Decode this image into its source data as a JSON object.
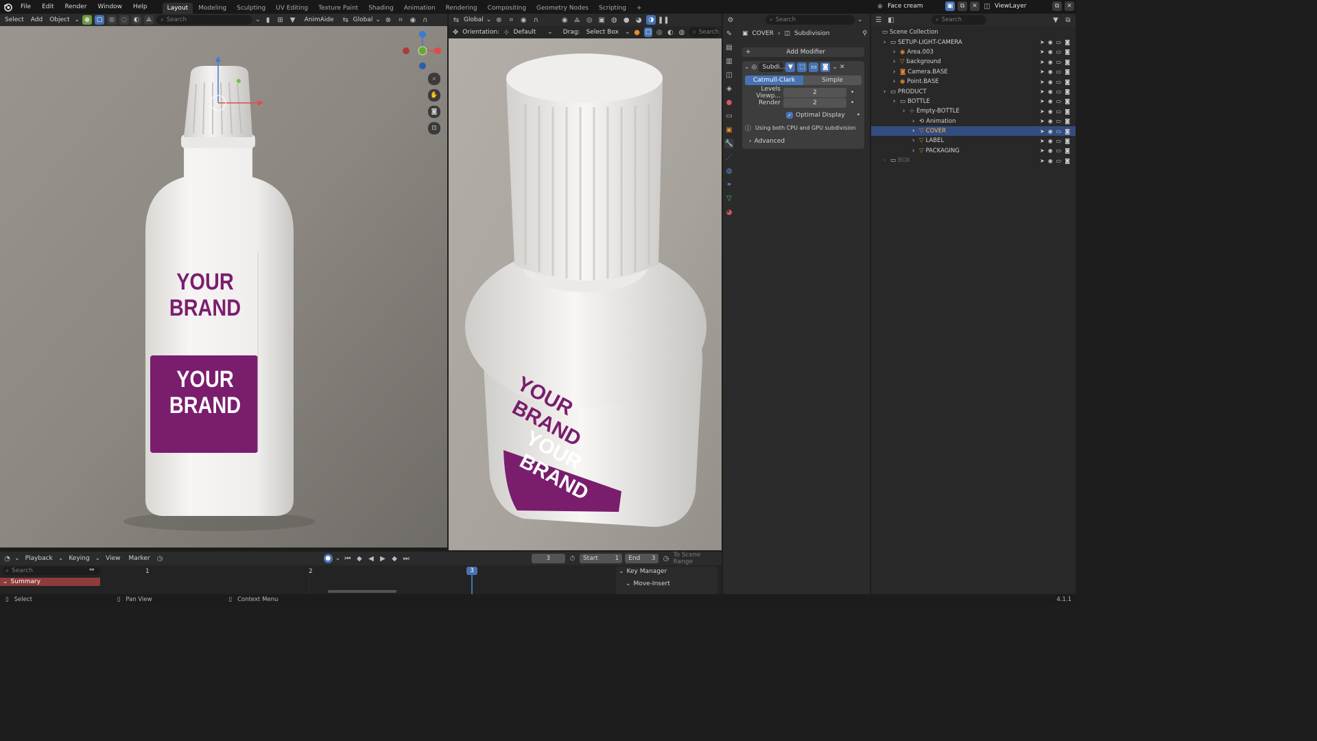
{
  "topmenu": {
    "items": [
      "File",
      "Edit",
      "Render",
      "Window",
      "Help"
    ]
  },
  "workspaces": [
    {
      "label": "Layout",
      "active": true
    },
    {
      "label": "Modeling"
    },
    {
      "label": "Sculpting"
    },
    {
      "label": "UV Editing"
    },
    {
      "label": "Texture Paint"
    },
    {
      "label": "Shading"
    },
    {
      "label": "Animation"
    },
    {
      "label": "Rendering"
    },
    {
      "label": "Compositing"
    },
    {
      "label": "Geometry Nodes"
    },
    {
      "label": "Scripting"
    }
  ],
  "scene_name": "Face cream",
  "view_layer": "ViewLayer",
  "viewport_left": {
    "menus": {
      "select": "Select",
      "add": "Add",
      "object": "Object"
    },
    "search_placeholder": "Search",
    "addon": "AnimAide",
    "transform": "Global"
  },
  "viewport_right": {
    "transform": "Global",
    "orientation_label": "Orientation:",
    "orientation_value": "Default",
    "drag_label": "Drag:",
    "drag_value": "Select Box",
    "search_placeholder": "Search"
  },
  "bottle": {
    "label_line1": "YOUR",
    "label_line2": "BRAND",
    "colors": {
      "band": "#7a1d6d",
      "text": "#7b1e6f",
      "body": "#ececea",
      "background": "#8d8780"
    }
  },
  "properties": {
    "search_placeholder": "Search",
    "breadcrumb_object": "COVER",
    "breadcrumb_modifier": "Subdivision",
    "add_modifier": "Add Modifier",
    "modifier_name": "Subdi...",
    "tabs": [
      "Catmull-Clark",
      "Simple"
    ],
    "levels_viewport_label": "Levels Viewp...",
    "levels_viewport_value": "2",
    "render_label": "Render",
    "render_value": "2",
    "optimal_display": "Optimal Display",
    "info_text": "Using both CPU and GPU subdivision",
    "advanced": "Advanced"
  },
  "outliner": {
    "search_placeholder": "Search",
    "root": "Scene Collection",
    "rows": [
      {
        "label": "SETUP-LIGHT-CAMERA",
        "indent": 1,
        "type": "collection"
      },
      {
        "label": "Area.003",
        "indent": 2,
        "type": "light"
      },
      {
        "label": "background",
        "indent": 2,
        "type": "mesh"
      },
      {
        "label": "Camera.BASE",
        "indent": 2,
        "type": "camera"
      },
      {
        "label": "Point.BASE",
        "indent": 2,
        "type": "light"
      },
      {
        "label": "PRODUCT",
        "indent": 1,
        "type": "collection"
      },
      {
        "label": "BOTTLE",
        "indent": 2,
        "type": "collection"
      },
      {
        "label": "Empty-BOTTLE",
        "indent": 3,
        "type": "empty"
      },
      {
        "label": "Animation",
        "indent": 4,
        "type": "anim"
      },
      {
        "label": "COVER",
        "indent": 4,
        "type": "mesh",
        "selected": true
      },
      {
        "label": "LABEL",
        "indent": 4,
        "type": "mesh"
      },
      {
        "label": "PACKAGING",
        "indent": 4,
        "type": "mesh"
      },
      {
        "label": "BOX",
        "indent": 1,
        "type": "collection",
        "disabled": true
      }
    ]
  },
  "timeline": {
    "menus": [
      "Playback",
      "Keying",
      "View",
      "Marker"
    ],
    "current_frame": "3",
    "start_label": "Start",
    "start_value": "1",
    "end_label": "End",
    "end_value": "3",
    "scene_range": "To Scene Range",
    "search_placeholder": "Search",
    "summary": "Summary",
    "ruler": [
      "1",
      "2",
      "3"
    ],
    "key_manager": "Key Manager",
    "move_insert": "Move-Insert"
  },
  "statusbar": {
    "select": "Select",
    "pan": "Pan View",
    "context": "Context Menu",
    "version": "4.1.1"
  },
  "colors": {
    "accent": "#4772b3",
    "selected_row": "#334d80",
    "timeline_playhead": "#4772b3"
  }
}
